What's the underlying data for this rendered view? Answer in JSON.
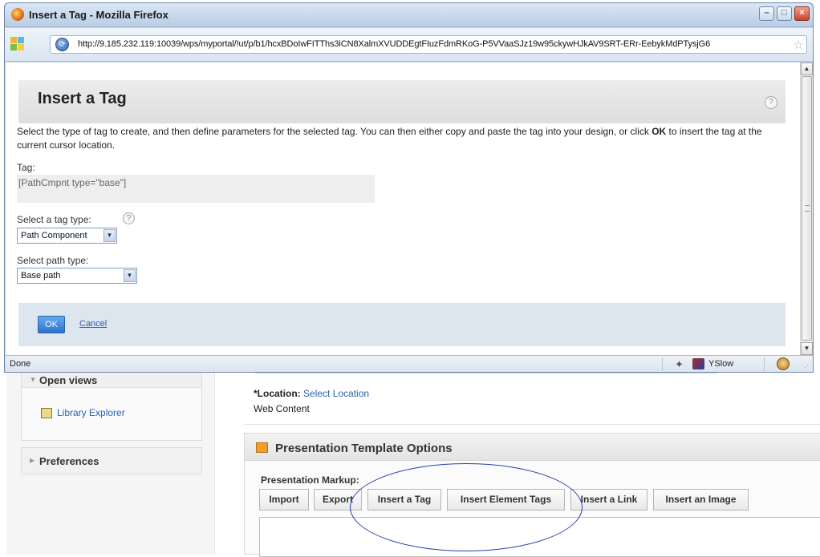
{
  "window": {
    "title": "Insert a Tag - Mozilla Firefox",
    "minimize": "–",
    "maximize": "□",
    "close": "×"
  },
  "address": {
    "url": "http://9.185.232.119:10039/wps/myportal/!ut/p/b1/hcxBDoIwFITThs3iCN8XalmXVUDDEgtFIuzFdmRKoG-P5VVaaSJz19w95ckywHJkAV9SRT-ERr-EebykMdPTysjG6"
  },
  "dialog": {
    "title": "Insert a Tag",
    "help": "?",
    "desc_part1": "Select the type of tag to create, and then define parameters for the selected tag. You can then either copy and paste the tag into your design, or click ",
    "desc_ok": "OK",
    "desc_part2": " to insert the tag at the current cursor location.",
    "tag_label": "Tag:",
    "tag_value": "[PathCmpnt type=\"base\"]",
    "tag_type_label": "Select a tag type:",
    "tag_type_value": "Path Component",
    "path_type_label": "Select path type:",
    "path_type_value": "Base path",
    "ok_label": "OK",
    "cancel_label": "Cancel"
  },
  "statusbar": {
    "status": "Done",
    "yslow": "YSlow"
  },
  "background": {
    "open_views": "Open views",
    "library_explorer": "Library Explorer",
    "preferences": "Preferences",
    "location_label": "*Location:",
    "location_link": "Select Location",
    "location_value": "Web Content",
    "pto_title": "Presentation Template Options",
    "markup_label": "Presentation Markup:",
    "toolbar_buttons": [
      "Import",
      "Export",
      "Insert a Tag",
      "Insert Element Tags",
      "Insert a Link",
      "Insert an Image"
    ]
  },
  "colors": {
    "link": "#2a62b0",
    "ok_button": "#2a74cc",
    "annotation": "#2a3fa8"
  }
}
